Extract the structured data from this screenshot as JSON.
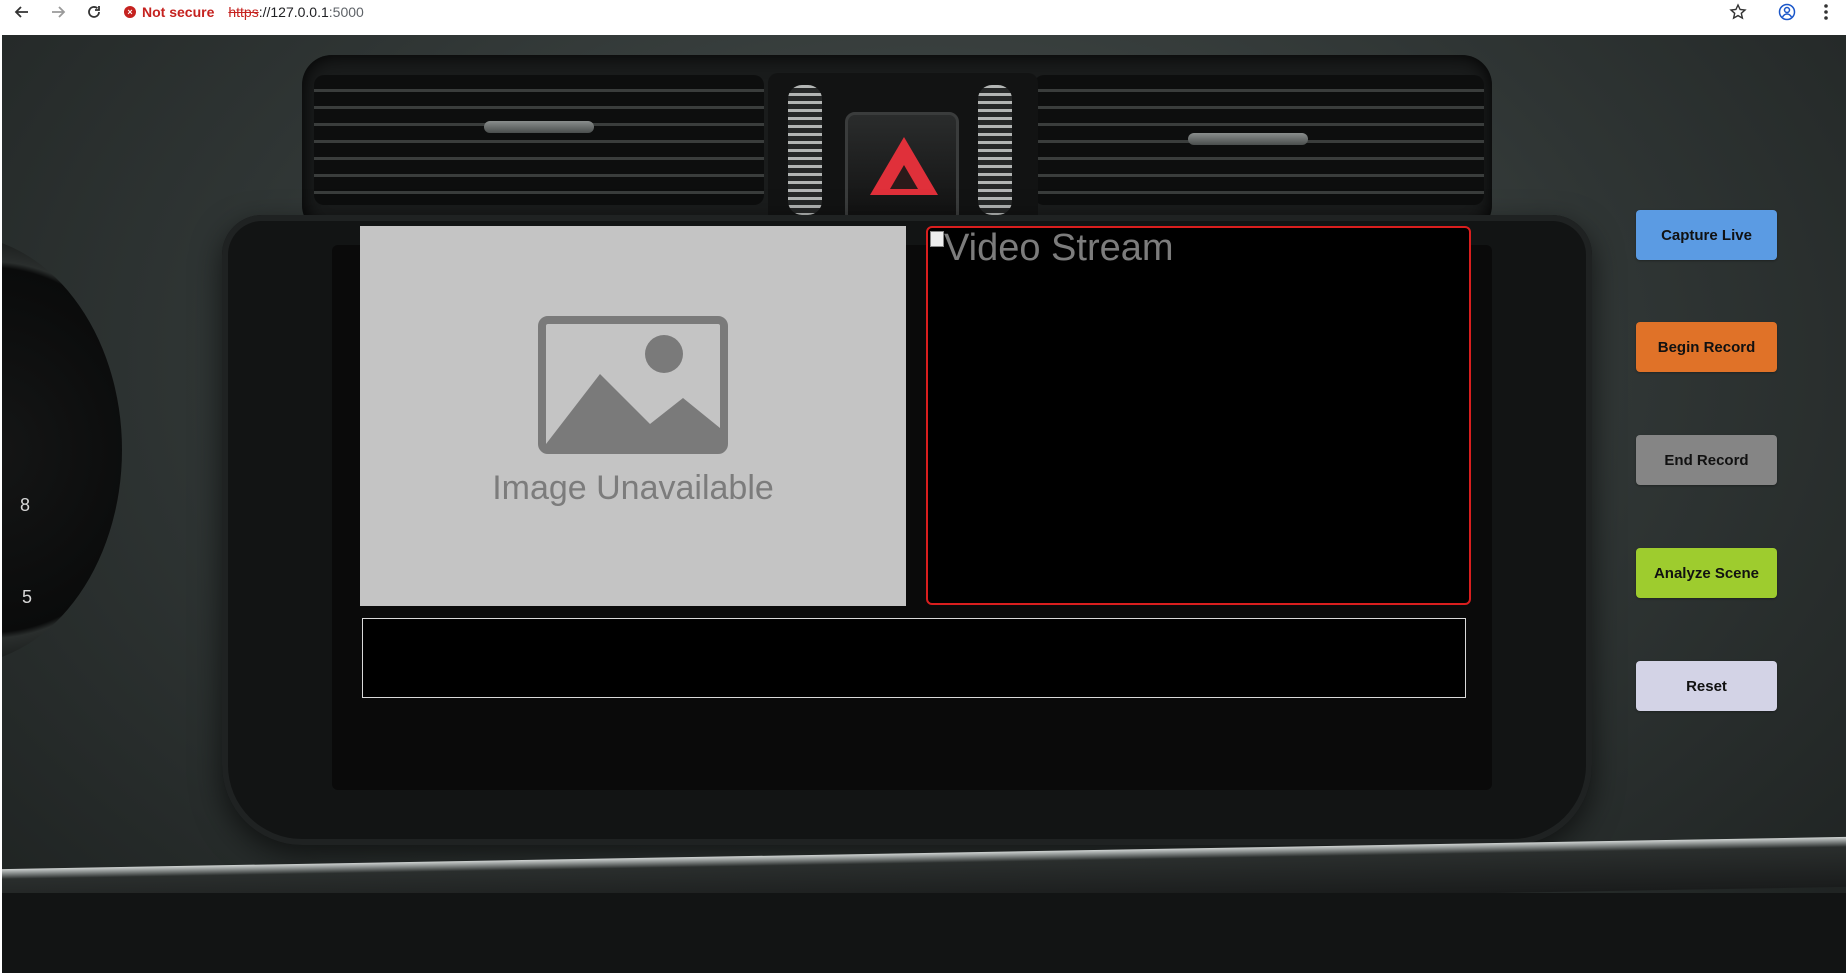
{
  "browser": {
    "security_label": "Not secure",
    "url_scheme": "https",
    "url_host": "://127.0.0.1",
    "url_port": ":5000"
  },
  "image_panel": {
    "caption": "Image Unavailable"
  },
  "video_panel": {
    "alt_text": "Video Stream"
  },
  "caption_box": {
    "text": ""
  },
  "controls": [
    {
      "label": "Capture Live",
      "color": "#5b9be3"
    },
    {
      "label": "Begin Record",
      "color": "#e07228"
    },
    {
      "label": "End Record",
      "color": "#858585"
    },
    {
      "label": "Analyze Scene",
      "color": "#9ecc2e"
    },
    {
      "label": "Reset",
      "color": "#d3d3e6"
    }
  ],
  "dashboard": {
    "gauge_labels": [
      "8",
      "5"
    ]
  }
}
